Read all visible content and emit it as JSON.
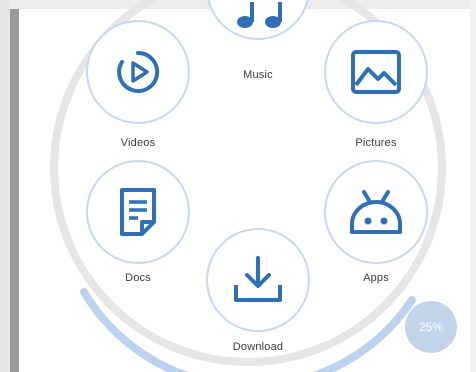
{
  "categories": [
    {
      "key": "music",
      "label": "Music",
      "icon": "music-note-icon"
    },
    {
      "key": "videos",
      "label": "Videos",
      "icon": "play-circle-icon"
    },
    {
      "key": "pictures",
      "label": "Pictures",
      "icon": "image-icon"
    },
    {
      "key": "docs",
      "label": "Docs",
      "icon": "document-icon"
    },
    {
      "key": "apps",
      "label": "Apps",
      "icon": "android-icon"
    },
    {
      "key": "download",
      "label": "Download",
      "icon": "download-icon"
    }
  ],
  "storage": {
    "percent_label": "25%",
    "fraction_used": 0.25
  },
  "colors": {
    "accent": "#2f6fb8",
    "ring_track": "#e6e6e6",
    "ring_fill": "#bcd3ee",
    "circle_border": "#c7d9ee"
  }
}
